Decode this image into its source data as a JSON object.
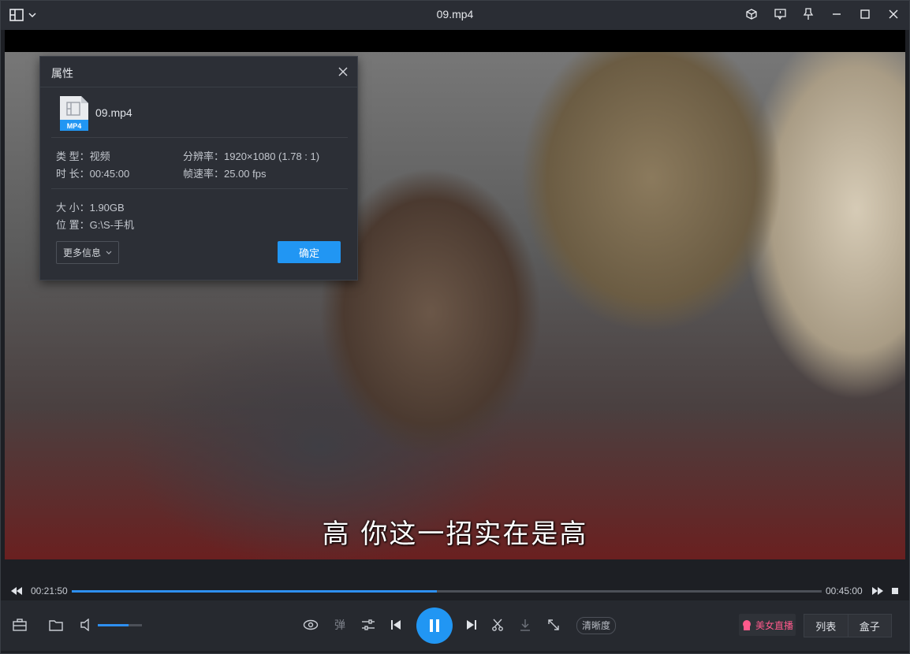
{
  "window": {
    "title": "09.mp4"
  },
  "player": {
    "subtitle": "高  你这一招实在是高",
    "current_time": "00:21:50",
    "total_time": "00:45:00",
    "progress": 0.487,
    "volume": 0.7
  },
  "controls": {
    "danmaku_label": "弹",
    "clarity_label": "清晰度",
    "live_label": "美女直播",
    "list_tab": "列表",
    "box_tab": "盒子"
  },
  "dialog": {
    "title": "属性",
    "file_name": "09.mp4",
    "file_badge": "MP4",
    "type": "类 型：视频",
    "duration": "时 长：00:45:00",
    "resolution": "分辨率：1920×1080 (1.78 : 1)",
    "framerate": "帧速率：25.00 fps",
    "size": "大 小：1.90GB",
    "location": "位 置：G:\\S-手机",
    "more_label": "更多信息",
    "ok_label": "确定"
  },
  "colors": {
    "accent": "#2196f3",
    "live": "#ff5a8c"
  }
}
